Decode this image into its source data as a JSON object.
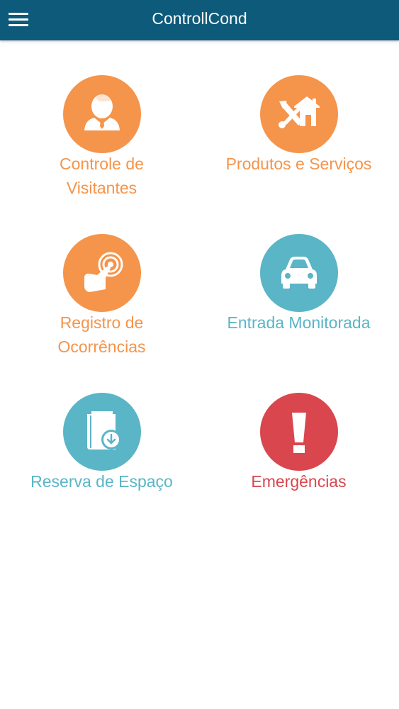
{
  "header": {
    "title": "ControllCond",
    "menu_icon": "hamburger-menu-icon"
  },
  "colors": {
    "header_bg": "#0e5a7b",
    "orange": "#f5944b",
    "teal": "#5ab5c6",
    "red": "#d9464e"
  },
  "tiles": [
    {
      "label_line1": "Controle de",
      "label_line2": "Visitantes",
      "icon": "visitor-icon",
      "color": "orange"
    },
    {
      "label_line1": "Produtos e Serviços",
      "label_line2": "",
      "icon": "tools-house-icon",
      "color": "orange"
    },
    {
      "label_line1": "Registro de",
      "label_line2": "Ocorrências",
      "icon": "report-incident-icon",
      "color": "orange"
    },
    {
      "label_line1": "Entrada Monitorada",
      "label_line2": "",
      "icon": "car-icon",
      "color": "teal"
    },
    {
      "label_line1": "Reserva de Espaço",
      "label_line2": "",
      "icon": "book-reservation-icon",
      "color": "teal"
    },
    {
      "label_line1": "Emergências",
      "label_line2": "",
      "icon": "exclamation-icon",
      "color": "red"
    }
  ]
}
